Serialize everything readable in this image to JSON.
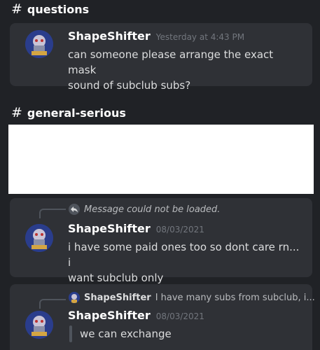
{
  "section1": {
    "channel_hash": "#",
    "channel_name": "questions",
    "message": {
      "username": "ShapeShifter",
      "timestamp": "Yesterday at 4:43 PM",
      "lines": [
        "can someone please arrange the exact mask",
        "sound of subclub subs?"
      ]
    }
  },
  "section2": {
    "channel_hash": "#",
    "channel_name": "general-serious",
    "message1": {
      "reply_text": "Message could not be loaded.",
      "username": "ShapeShifter",
      "timestamp": "08/03/2021",
      "lines": [
        "i have some paid ones too so dont care rn... i",
        "want subclub only"
      ]
    },
    "message2": {
      "reply_user": "ShapeShifter",
      "reply_text": "I have many subs from subclub, i...",
      "username": "ShapeShifter",
      "timestamp": "08/03/2021",
      "text": "we can exchange"
    }
  },
  "colors": {
    "background": "#202226",
    "card": "#2f3136",
    "username": "#ffffff",
    "timestamp": "#72767d",
    "text": "#dcddde"
  },
  "icons": [
    "hash-icon",
    "reply-arrow-icon",
    "avatar-image"
  ]
}
